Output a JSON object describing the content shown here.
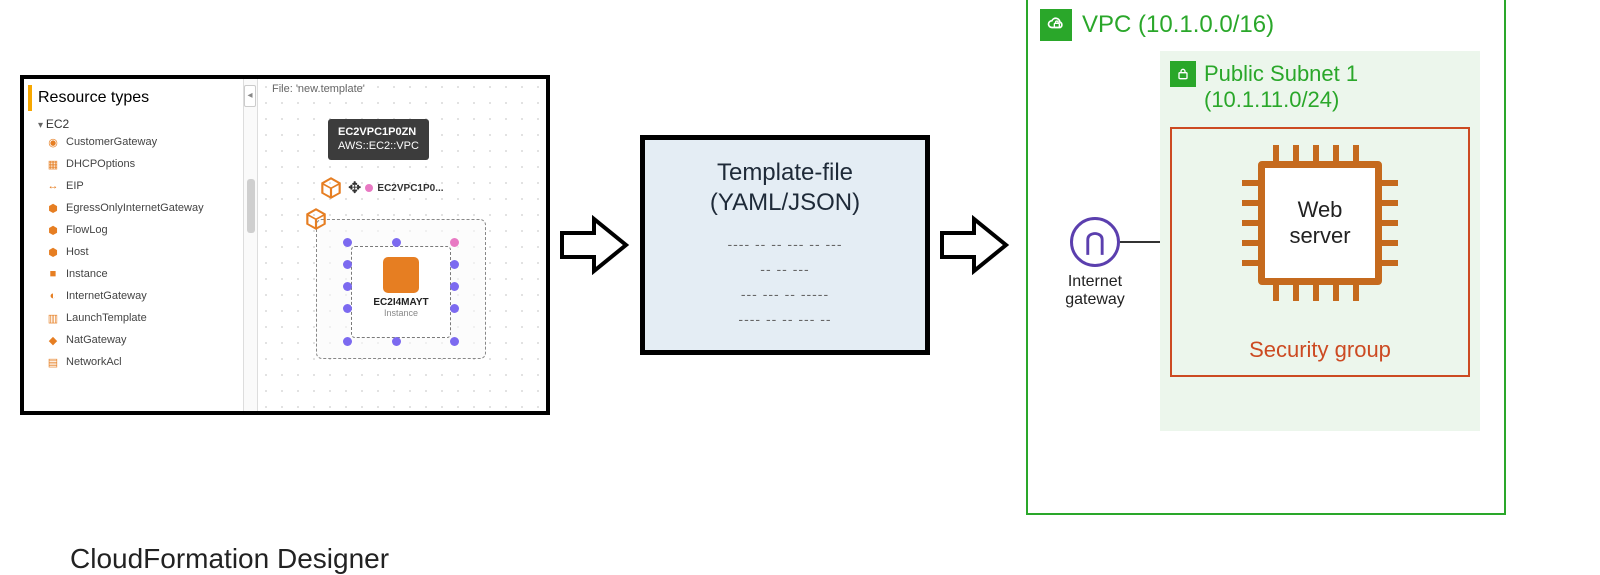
{
  "designer": {
    "caption": "CloudFormation Designer",
    "resource_header": "Resource types",
    "group": "EC2",
    "items": [
      {
        "label": "CustomerGateway",
        "icon": "◉"
      },
      {
        "label": "DHCPOptions",
        "icon": "▦"
      },
      {
        "label": "EIP",
        "icon": "↔"
      },
      {
        "label": "EgressOnlyInternetGateway",
        "icon": "⬢"
      },
      {
        "label": "FlowLog",
        "icon": "⬢"
      },
      {
        "label": "Host",
        "icon": "⬢"
      },
      {
        "label": "Instance",
        "icon": "■"
      },
      {
        "label": "InternetGateway",
        "icon": "◐"
      },
      {
        "label": "LaunchTemplate",
        "icon": "▥"
      },
      {
        "label": "NatGateway",
        "icon": "◆"
      },
      {
        "label": "NetworkAcl",
        "icon": "▤"
      }
    ],
    "file_label": "File: 'new.template'",
    "collapse_glyph": "◂",
    "tooltip": {
      "l1": "EC2VPC1P0ZN",
      "l2": "AWS::EC2::VPC"
    },
    "drag_label": "EC2VPC1P0...",
    "instance": {
      "name": "EC2I4MAYT",
      "type": "Instance"
    }
  },
  "template": {
    "title_l1": "Template-file",
    "title_l2": "(YAML/JSON)",
    "rows": [
      "---- -- -- --- -- ---",
      "-- -- ---",
      "--- --- -- -----",
      "---- -- -- --- --"
    ]
  },
  "stack": {
    "vpc_label": "VPC (10.1.0.0/16)",
    "subnet_label": "Public Subnet 1",
    "subnet_cidr": "(10.1.11.0/24)",
    "web_l1": "Web",
    "web_l2": "server",
    "sg_label": "Security group",
    "igw_glyph": "⋂",
    "igw_l1": "Internet",
    "igw_l2": "gateway"
  }
}
